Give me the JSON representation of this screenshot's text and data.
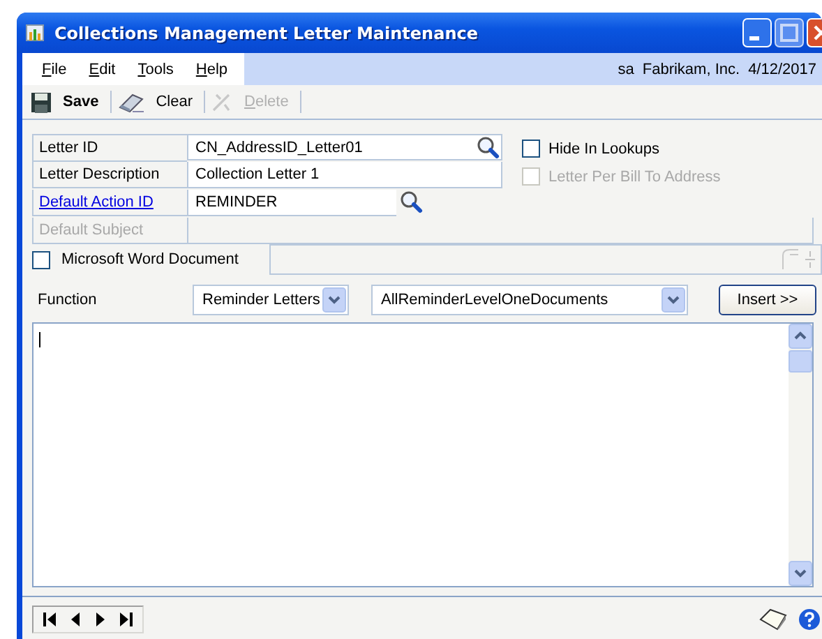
{
  "window": {
    "title": "Collections Management Letter Maintenance"
  },
  "menu": [
    {
      "label": "File"
    },
    {
      "label": "Edit"
    },
    {
      "label": "Tools"
    },
    {
      "label": "Help"
    }
  ],
  "session": {
    "user": "sa",
    "company": "Fabrikam, Inc.",
    "date": "4/12/2017"
  },
  "toolbar": [
    {
      "kind": "save",
      "label": "Save",
      "disabled": false
    },
    {
      "kind": "clear",
      "label": "Clear",
      "disabled": false
    },
    {
      "kind": "delete",
      "label": "Delete",
      "disabled": true
    }
  ],
  "fields": [
    {
      "label": "Letter ID",
      "value": "CN_AddressID_Letter01",
      "kind": "lookup",
      "link": false,
      "disabled": false
    },
    {
      "label": "Letter Description",
      "value": "Collection Letter 1",
      "kind": "text",
      "link": false,
      "disabled": false
    },
    {
      "label": "Default Action ID",
      "value": "REMINDER",
      "kind": "lookup",
      "link": true,
      "disabled": false
    },
    {
      "label": "Default Subject",
      "kind": "wide",
      "link": false,
      "disabled": true
    }
  ],
  "options": [
    {
      "label": "Hide In Lookups",
      "checked": false,
      "disabled": false
    },
    {
      "label": "Letter Per Bill To Address",
      "checked": false,
      "disabled": true
    }
  ],
  "word_document": {
    "label": "Microsoft Word Document",
    "checked": false
  },
  "function": {
    "label": "Function",
    "category": "Reminder Letters",
    "item": "AllReminderLevelOneDocuments",
    "button": "Insert >>"
  }
}
